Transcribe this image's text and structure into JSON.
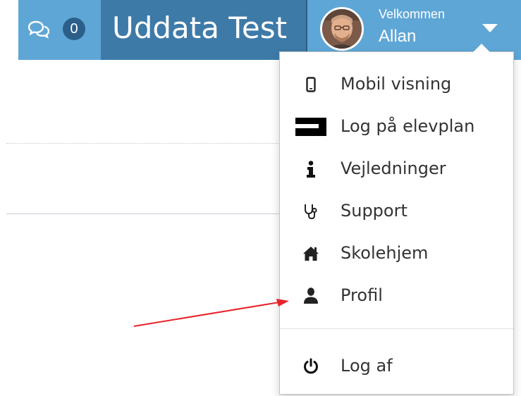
{
  "header": {
    "chat_count": "0",
    "title": "Uddata Test",
    "welcome_small": "Velkommen",
    "user_name": "Allan"
  },
  "menu": {
    "items": [
      {
        "label": "Mobil visning",
        "icon": "mobile-icon"
      },
      {
        "label": "Log på elevplan",
        "icon": "elevplan-icon"
      },
      {
        "label": "Vejledninger",
        "icon": "info-icon"
      },
      {
        "label": "Support",
        "icon": "stethoscope-icon"
      },
      {
        "label": "Skolehjem",
        "icon": "home-icon"
      },
      {
        "label": "Profil",
        "icon": "user-icon"
      }
    ],
    "logout": {
      "label": "Log af",
      "icon": "power-icon"
    }
  },
  "colors": {
    "header_light": "#5ea6d6",
    "header_dark": "#3e7aa8",
    "badge": "#2b5f8a",
    "annotation_arrow": "#e8222a"
  }
}
